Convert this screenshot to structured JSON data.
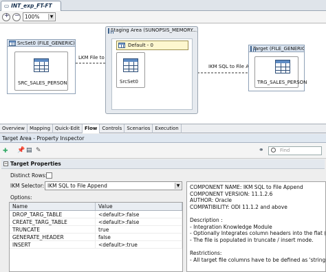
{
  "document_tab": {
    "title": "INT_exp_FT-FT"
  },
  "toolbar": {
    "zoom_value": "100%"
  },
  "diagram": {
    "source_panel": {
      "title": "SrcSet0 (FILE_GENERIC)",
      "datastore": "SRC_SALES_PERSON"
    },
    "staging_area": {
      "title": "Staging Area (SUNOPSIS_MEMORY...)",
      "default_label": "Default - 0",
      "datastore": "SrcSet0"
    },
    "target_panel": {
      "title": "Target (FILE_GENERIC)",
      "datastore": "TRG_SALES_PERSON"
    },
    "lkm_label": "LKM File to SQL",
    "ikm_label": "IKM SQL to File Append"
  },
  "bottom_tabs": [
    "Overview",
    "Mapping",
    "Quick-Edit",
    "Flow",
    "Controls",
    "Scenarios",
    "Execution"
  ],
  "active_bottom_tab": "Flow",
  "inspector": {
    "title": "Target Area - Property Inspector",
    "find_placeholder": "Find",
    "section_title": "Target Properties",
    "distinct_rows_label": "Distinct Rows:",
    "ikm_selector_label": "IKM Selector:",
    "ikm_selected": "IKM SQL to File Append",
    "options_label": "Options:",
    "options_table": {
      "columns": [
        "Name",
        "Value"
      ],
      "rows": [
        {
          "name": "DROP_TARG_TABLE",
          "value": "<default>:false"
        },
        {
          "name": "CREATE_TARG_TABLE",
          "value": "<default>:false"
        },
        {
          "name": "TRUNCATE",
          "value": "true"
        },
        {
          "name": "GENERATE_HEADER",
          "value": "false"
        },
        {
          "name": "INSERT",
          "value": "<default>:true"
        }
      ]
    },
    "description_lines": [
      "COMPONENT NAME: IKM SQL to File Append",
      "COMPONENT VERSION: 11.1.2.6",
      "AUTHOR: Oracle",
      "COMPATIBILITY: ODI 11.1.2 and above",
      "",
      "Description :",
      "- Integration Knowledge Module",
      "- Optionally Integrates column headers into the flat (Delimited",
      "- The file is populated in truncate / insert mode.",
      "",
      "Restrictions:",
      "- All target file columns have to be defined as 'string'"
    ]
  }
}
